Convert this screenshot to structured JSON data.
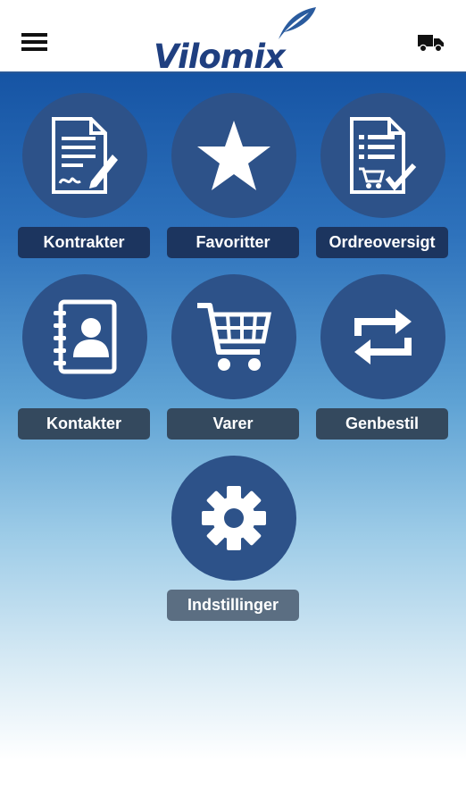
{
  "header": {
    "brand": "Vilomix",
    "menu_icon": "hamburger-menu-icon",
    "cart_icon": "truck-icon"
  },
  "tiles": [
    {
      "label": "Kontrakter",
      "icon": "contract-document-icon"
    },
    {
      "label": "Favoritter",
      "icon": "star-icon"
    },
    {
      "label": "Ordreoversigt",
      "icon": "order-list-icon"
    },
    {
      "label": "Kontakter",
      "icon": "address-book-icon"
    },
    {
      "label": "Varer",
      "icon": "shopping-cart-icon"
    },
    {
      "label": "Genbestil",
      "icon": "reorder-arrows-icon"
    },
    {
      "label": "Indstillinger",
      "icon": "gear-icon"
    }
  ],
  "colors": {
    "header_border": "#2a5896",
    "circle": "#2d5289",
    "brand": "#1f3f80"
  }
}
